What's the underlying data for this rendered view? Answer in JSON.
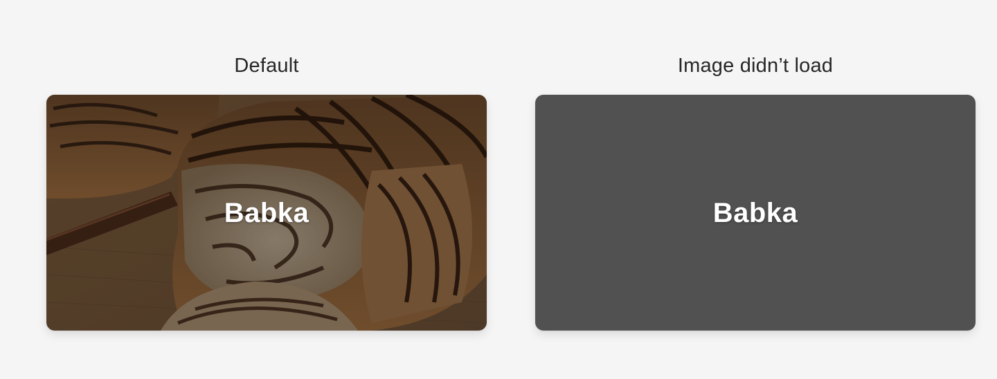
{
  "cards": [
    {
      "caption": "Default",
      "label": "Babka",
      "state": "image",
      "image_subject": "sliced chocolate babka ring on a wooden board"
    },
    {
      "caption": "Image didn’t load",
      "label": "Babka",
      "state": "fallback",
      "fallback_color": "#515151"
    }
  ],
  "colors": {
    "page_background": "#f5f5f5",
    "caption_text": "#262626",
    "label_text": "#ffffff"
  }
}
